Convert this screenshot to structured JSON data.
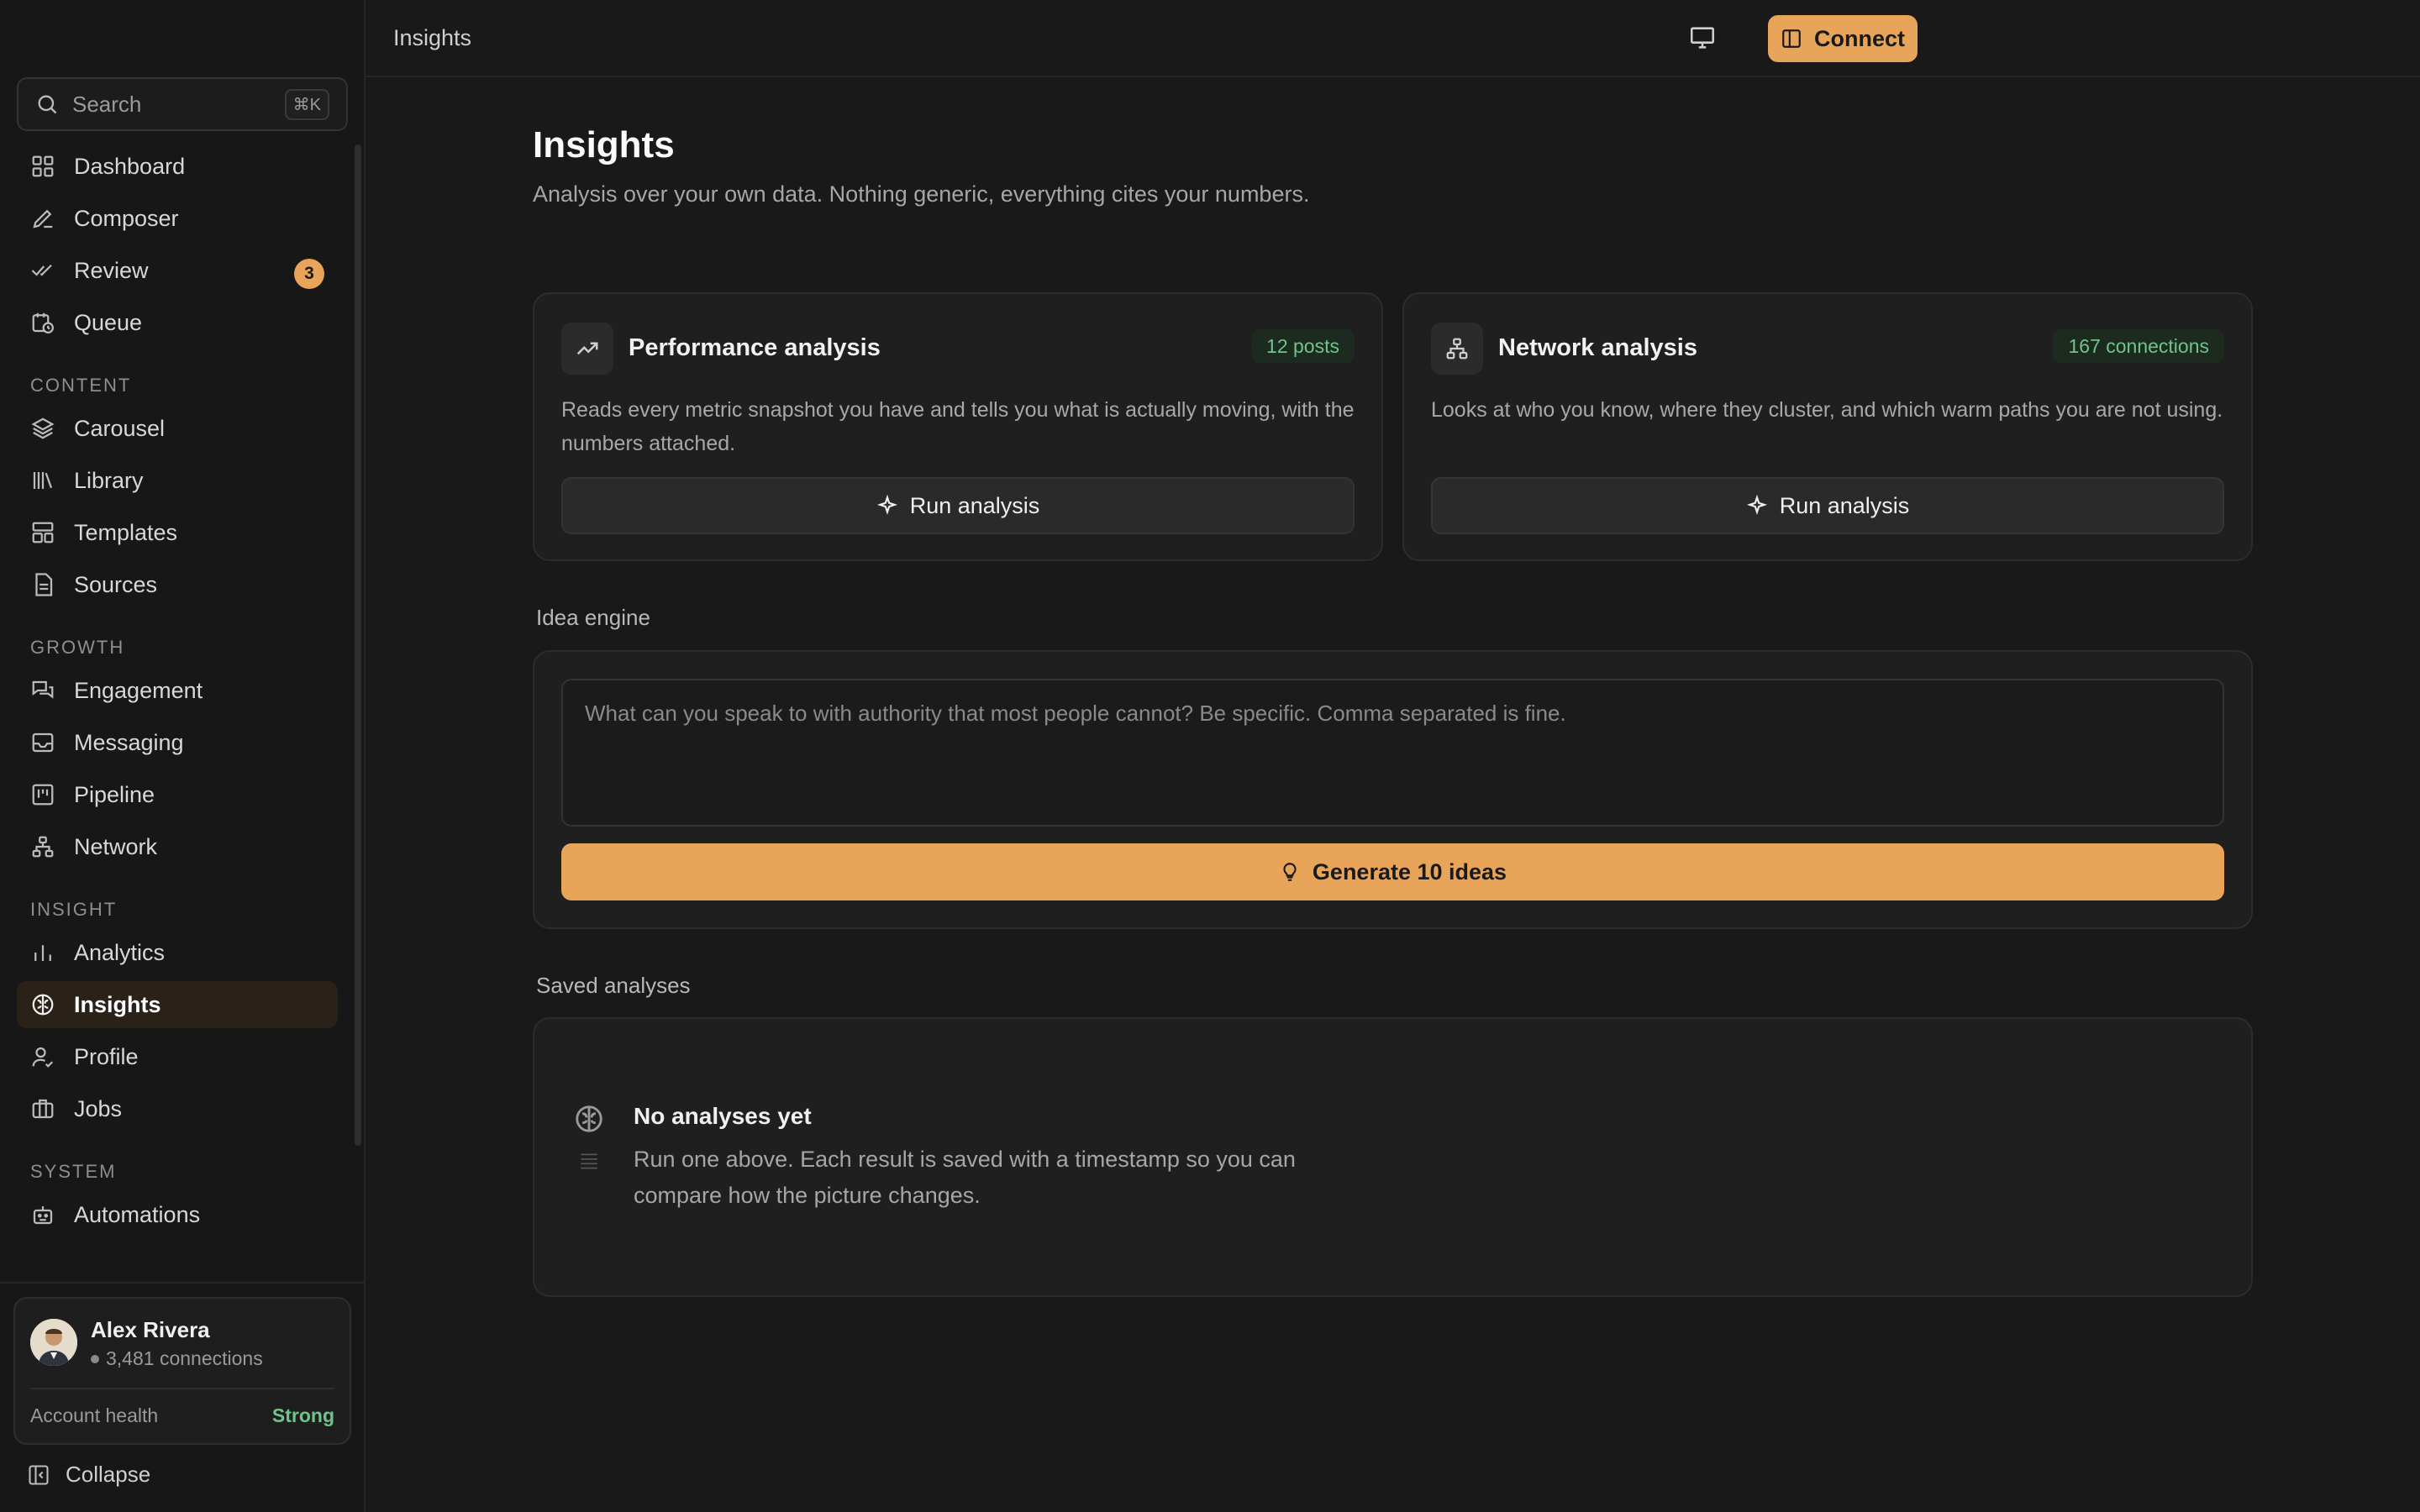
{
  "sidebar": {
    "search": {
      "label": "Search",
      "shortcut": "⌘K"
    },
    "primary": [
      {
        "label": "Dashboard",
        "icon": "grid-icon"
      },
      {
        "label": "Composer",
        "icon": "pencil-icon"
      },
      {
        "label": "Review",
        "icon": "double-check-icon",
        "badge": "3"
      },
      {
        "label": "Queue",
        "icon": "calendar-clock-icon"
      }
    ],
    "sections": [
      {
        "title": "CONTENT",
        "items": [
          "Carousel",
          "Library",
          "Templates",
          "Sources"
        ]
      },
      {
        "title": "GROWTH",
        "items": [
          "Engagement",
          "Messaging",
          "Pipeline",
          "Network"
        ]
      },
      {
        "title": "INSIGHT",
        "items": [
          "Analytics",
          "Insights",
          "Profile",
          "Jobs"
        ]
      },
      {
        "title": "SYSTEM",
        "items": [
          "Automations"
        ]
      }
    ],
    "active_item": "Insights",
    "user": {
      "name": "Alex Rivera",
      "connections": "3,481 connections",
      "health_label": "Account health",
      "health_value": "Strong"
    },
    "collapse_label": "Collapse"
  },
  "topbar": {
    "breadcrumb": "Insights",
    "connect_label": "Connect"
  },
  "page": {
    "title": "Insights",
    "subtitle": "Analysis over your own data. Nothing generic, everything cites your numbers."
  },
  "cards": {
    "performance": {
      "title": "Performance analysis",
      "pill": "12 posts",
      "desc": "Reads every metric snapshot you have and tells you what is actually moving, with the numbers attached.",
      "button": "Run analysis"
    },
    "network": {
      "title": "Network analysis",
      "pill": "167 connections",
      "desc": "Looks at who you know, where they cluster, and which warm paths you are not using.",
      "button": "Run analysis"
    }
  },
  "idea_engine": {
    "label": "Idea engine",
    "placeholder": "What can you speak to with authority that most people cannot? Be specific. Comma separated is fine.",
    "button": "Generate 10 ideas"
  },
  "saved": {
    "label": "Saved analyses",
    "empty_title": "No analyses yet",
    "empty_desc": "Run one above. Each result is saved with a timestamp so you can compare how the picture changes."
  },
  "colors": {
    "accent": "#e8a559",
    "success": "#6fc48a",
    "background": "#191919"
  }
}
